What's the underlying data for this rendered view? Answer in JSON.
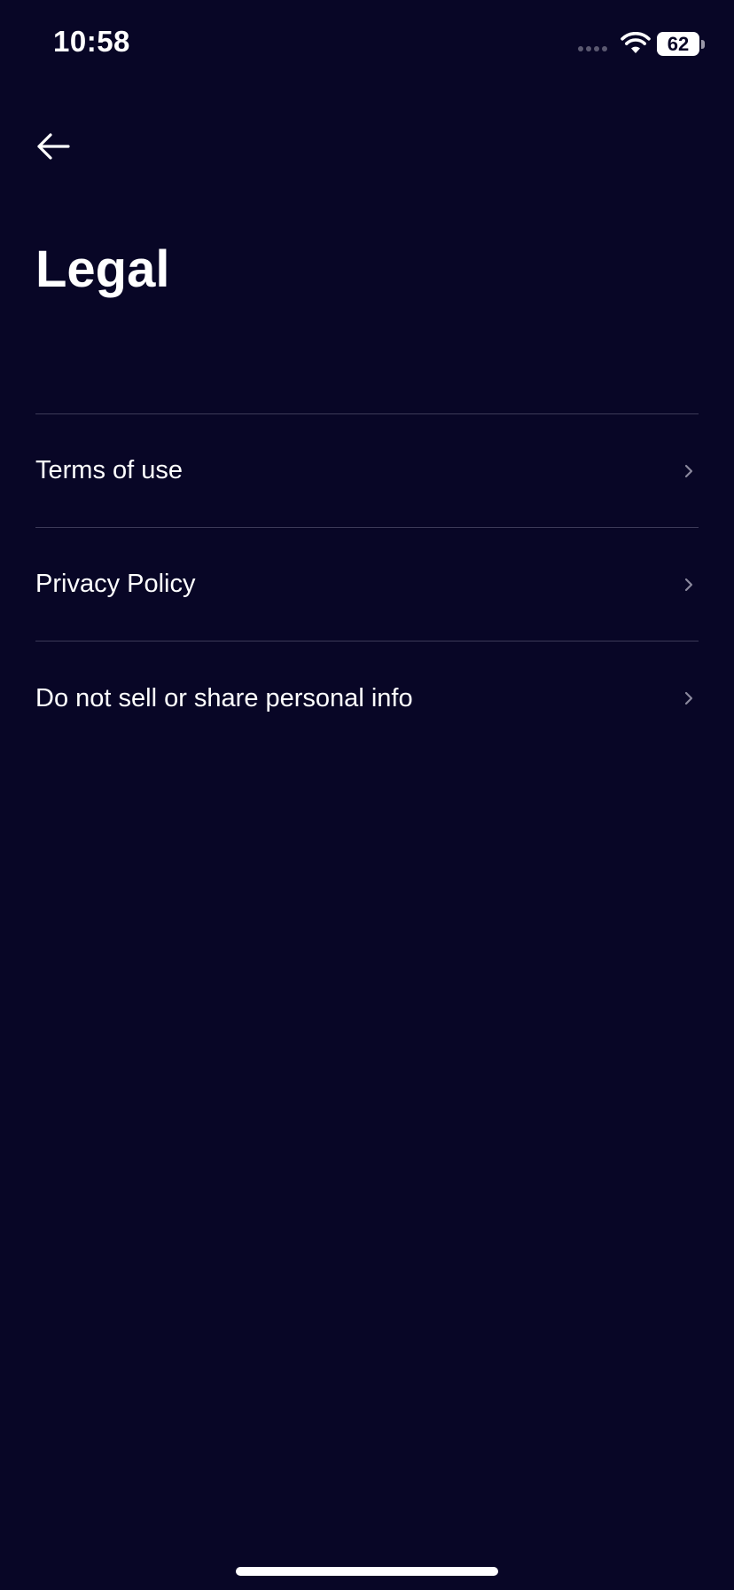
{
  "status_bar": {
    "time": "10:58",
    "battery": "62"
  },
  "header": {
    "back_icon": "arrow-left-icon",
    "title": "Legal"
  },
  "legal_items": [
    {
      "label": "Terms of use",
      "icon": "chevron-right-icon"
    },
    {
      "label": "Privacy Policy",
      "icon": "chevron-right-icon"
    },
    {
      "label": "Do not sell or share personal info",
      "icon": "chevron-right-icon"
    }
  ],
  "colors": {
    "background": "#080626",
    "text": "#ffffff",
    "divider": "#3c3a58",
    "chevron": "#8a889c"
  }
}
